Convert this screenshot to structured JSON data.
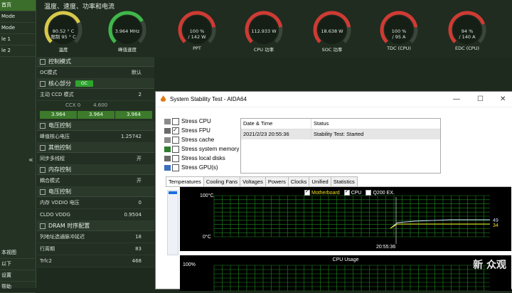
{
  "sidebar": {
    "top_items": [
      "首页",
      "Mode",
      "Mode",
      "le 1",
      "le 2"
    ],
    "bottom_items": [
      "本视图",
      "以下",
      "设置",
      "帮助"
    ]
  },
  "header": {
    "section_title": "温度、速度、功率和电流",
    "gauges": [
      {
        "value": "80.52 ° C",
        "value2": "限制 95 ° C",
        "label": "温度",
        "fraction": 0.74,
        "color": "#d8c84a"
      },
      {
        "value": "3.964 MHz",
        "value2": "",
        "label": "峰值速度",
        "fraction": 0.72,
        "color": "#3fb84a"
      },
      {
        "value": "100 %",
        "value2": "/ 142 W",
        "label": "PPT",
        "fraction": 0.8,
        "color": "#d03a34"
      },
      {
        "value": "112.933 W",
        "value2": "",
        "label": "CPU 功率",
        "fraction": 0.8,
        "color": "#d03a34"
      },
      {
        "value": "18.638 W",
        "value2": "",
        "label": "SOC 功率",
        "fraction": 0.8,
        "color": "#d03a34"
      },
      {
        "value": "100 %",
        "value2": "/ 95 A",
        "label": "TDC (CPU)",
        "fraction": 0.8,
        "color": "#d03a34"
      },
      {
        "value": "94 %",
        "value2": "/ 140 A",
        "label": "EDC (CPU)",
        "fraction": 0.76,
        "color": "#d03a34"
      }
    ]
  },
  "settings": {
    "control_mode_title": "控制模式",
    "oc_mode_label": "OC模式",
    "oc_mode_value": "默认",
    "core_section_title": "核心部分",
    "core_badge": "OC",
    "ccd_label": "主动 CCD 模式",
    "ccd_value": "2",
    "ccx_header": [
      "CCX 0",
      "4.600"
    ],
    "ccx_cells": [
      "3.964",
      "3.964",
      "3.964"
    ],
    "voltage_title": "电压控制",
    "peak_voltage_label": "峰值核心电压",
    "peak_voltage_value": "1.25742",
    "other_title": "其他控制",
    "smt_label": "同步多线程",
    "smt_value": "开",
    "memory_title": "内存控制",
    "coupled_label": "耦合模式",
    "coupled_value": "开",
    "volt_ctrl_title": "电压控制",
    "vddio_label": "内存 VDDIO 电压",
    "vddio_value": "0",
    "cldo_label": "CLDO VDDG",
    "cldo_value": "0.9504",
    "dram_title": "DRAM 时序配置",
    "burst_label": "列地址选通脉冲延迟",
    "burst_value": "18",
    "cycle_label": "行周期",
    "cycle_value": "83",
    "trfc_label": "Trfc2",
    "trfc_value": "468"
  },
  "aida": {
    "title": "System Stability Test - AIDA64",
    "stress_items": [
      {
        "label": "Stress CPU",
        "checked": false
      },
      {
        "label": "Stress FPU",
        "checked": true
      },
      {
        "label": "Stress cache",
        "checked": false
      },
      {
        "label": "Stress system memory",
        "checked": false
      },
      {
        "label": "Stress local disks",
        "checked": false
      },
      {
        "label": "Stress GPU(s)",
        "checked": false
      }
    ],
    "log_headers": [
      "Date & Time",
      "Status"
    ],
    "log_row": [
      "2021/2/23 20:55:36",
      "Stability Test: Started"
    ],
    "tabs": [
      "Temperatures",
      "Cooling Fans",
      "Voltages",
      "Powers",
      "Clocks",
      "Unified",
      "Statistics"
    ],
    "legend": [
      "Motherboard",
      "CPU",
      "Q200 EX."
    ],
    "temp_max_label": "100°C",
    "temp_min_label": "0°C",
    "time_label": "20:55:36",
    "val_49": "49",
    "val_34": "34",
    "usage_title": "CPU Usage",
    "usage_max": "100%"
  },
  "watermark": "新 众观",
  "colors": {
    "accent": "#2fa42f",
    "line1": "#c8d8ff",
    "line2": "#f0e020"
  }
}
